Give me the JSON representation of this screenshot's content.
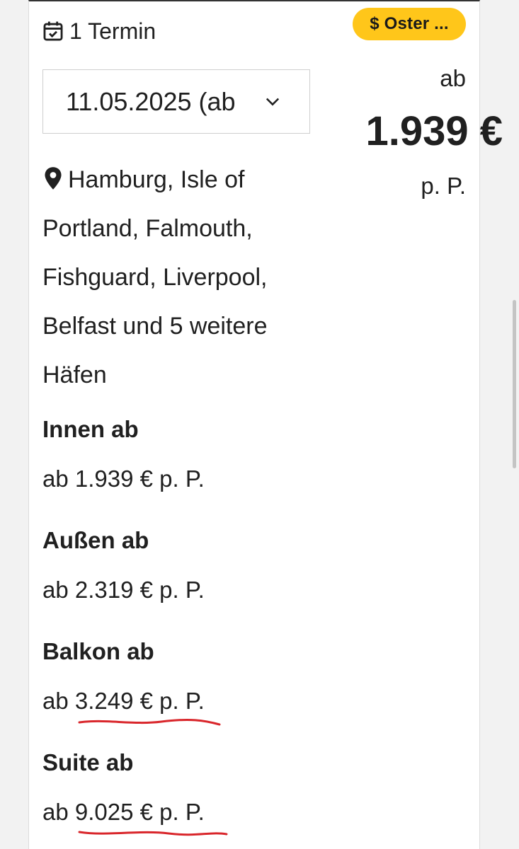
{
  "header": {
    "termin_label": "1 Termin",
    "badge_label": "$ Oster ..."
  },
  "date_select": {
    "value": "11.05.2025 (ab"
  },
  "price": {
    "prefix": "ab",
    "amount": "1.939 €",
    "suffix": "p. P."
  },
  "route": {
    "text": "Hamburg, Isle of Portland, Falmouth, Fishguard, Liverpool, Belfast und 5 weitere Häfen"
  },
  "cabins": [
    {
      "label": "Innen ab",
      "price_text": "ab 1.939 € p. P."
    },
    {
      "label": "Außen ab",
      "price_text": "ab 2.319 € p. P."
    },
    {
      "label": "Balkon ab",
      "price_text": "ab 3.249 € p. P."
    },
    {
      "label": "Suite ab",
      "price_text": "ab 9.025 € p. P."
    }
  ],
  "colors": {
    "badge": "#ffc61a",
    "annotation_underline": "#d9262b",
    "text": "#202020",
    "border": "#cfcfcf"
  },
  "icons": [
    "calendar-check-icon",
    "chevron-down-icon",
    "map-pin-icon"
  ]
}
